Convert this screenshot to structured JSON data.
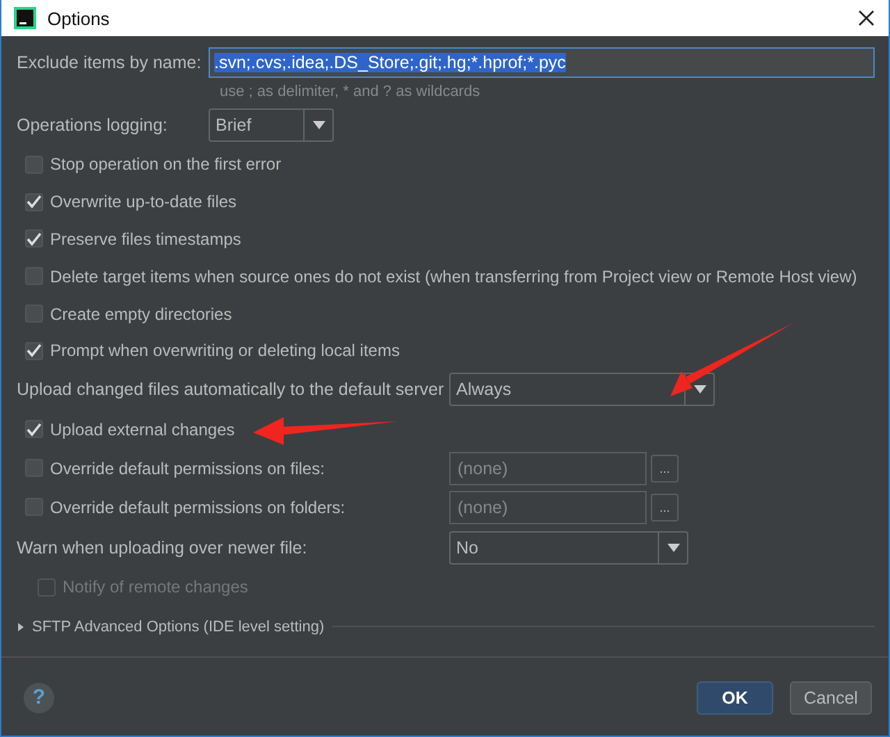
{
  "window": {
    "title": "Options"
  },
  "exclude": {
    "label": "Exclude items by name:",
    "value": ".svn;.cvs;.idea;.DS_Store;.git;.hg;*.hprof;*.pyc",
    "selected": true,
    "hint": "use ; as delimiter, * and ? as wildcards"
  },
  "logging": {
    "label": "Operations logging:",
    "value": "Brief"
  },
  "options": [
    {
      "label": "Stop operation on the first error",
      "checked": false
    },
    {
      "label": "Overwrite up-to-date files",
      "checked": true
    },
    {
      "label": "Preserve files timestamps",
      "checked": true
    },
    {
      "label": "Delete target items when source ones do not exist (when transferring from Project view or Remote Host view)",
      "checked": false
    },
    {
      "label": "Create empty directories",
      "checked": false
    },
    {
      "label": "Prompt when overwriting or deleting local items",
      "checked": true
    }
  ],
  "upload": {
    "label": "Upload changed files automatically to the default server",
    "value": "Always"
  },
  "external": {
    "label": "Upload external changes",
    "checked": true
  },
  "permissions": [
    {
      "label": "Override default permissions on files:",
      "checked": false,
      "placeholder": "(none)",
      "browse": "..."
    },
    {
      "label": "Override default permissions on folders:",
      "checked": false,
      "placeholder": "(none)",
      "browse": "..."
    }
  ],
  "warn": {
    "label": "Warn when uploading over newer file:",
    "value": "No"
  },
  "notify": {
    "label": "Notify of remote changes",
    "checked": false,
    "disabled": true
  },
  "advanced": {
    "label": "SFTP Advanced Options (IDE level setting)",
    "expanded": false
  },
  "help": "?",
  "buttons": [
    {
      "label": "OK",
      "default": true
    },
    {
      "label": "Cancel",
      "default": false
    }
  ]
}
